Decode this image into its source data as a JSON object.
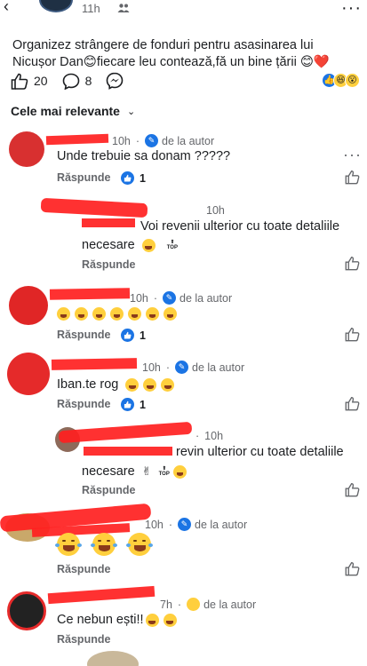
{
  "header": {
    "back_icon": "chevron-left-icon",
    "time": "11h",
    "audience_icon": "friends-icon",
    "more_icon": "more-horizontal-icon"
  },
  "post": {
    "text": "Organizez strângere de fonduri pentru asasinarea lui Nicușor Dan😊fiecare leu contează,fă un bine țării 😊❤️",
    "like_count": "20",
    "comment_count": "8",
    "reaction_icons": [
      "like",
      "haha",
      "wow"
    ]
  },
  "sort": {
    "label": "Cele mai relevante"
  },
  "comments": [
    {
      "time": "10h",
      "author_tag": "de la autor",
      "text": "Unde trebuie sa donam ?????",
      "reply_label": "Răspunde",
      "likes": "1"
    },
    {
      "time": "10h",
      "text": "Voi revenii ulterior cu toate detaliile necesare",
      "reply_label": "Răspunde",
      "top_label": "TOP"
    },
    {
      "time": "10h",
      "author_tag": "de la autor",
      "reply_label": "Răspunde",
      "likes": "1"
    },
    {
      "time": "10h",
      "author_tag": "de la autor",
      "text": "Iban.te rog",
      "reply_label": "Răspunde",
      "likes": "1"
    },
    {
      "time": "10h",
      "text": "revin ulterior cu toate detaliile necesare",
      "reply_label": "Răspunde",
      "top_label": "TOP"
    },
    {
      "time": "10h",
      "author_tag": "de la autor",
      "reply_label": "Răspunde"
    },
    {
      "time": "7h",
      "author_tag": "de la autor",
      "text": "Ce nebun ești!!",
      "reply_label": "Răspunde"
    }
  ]
}
